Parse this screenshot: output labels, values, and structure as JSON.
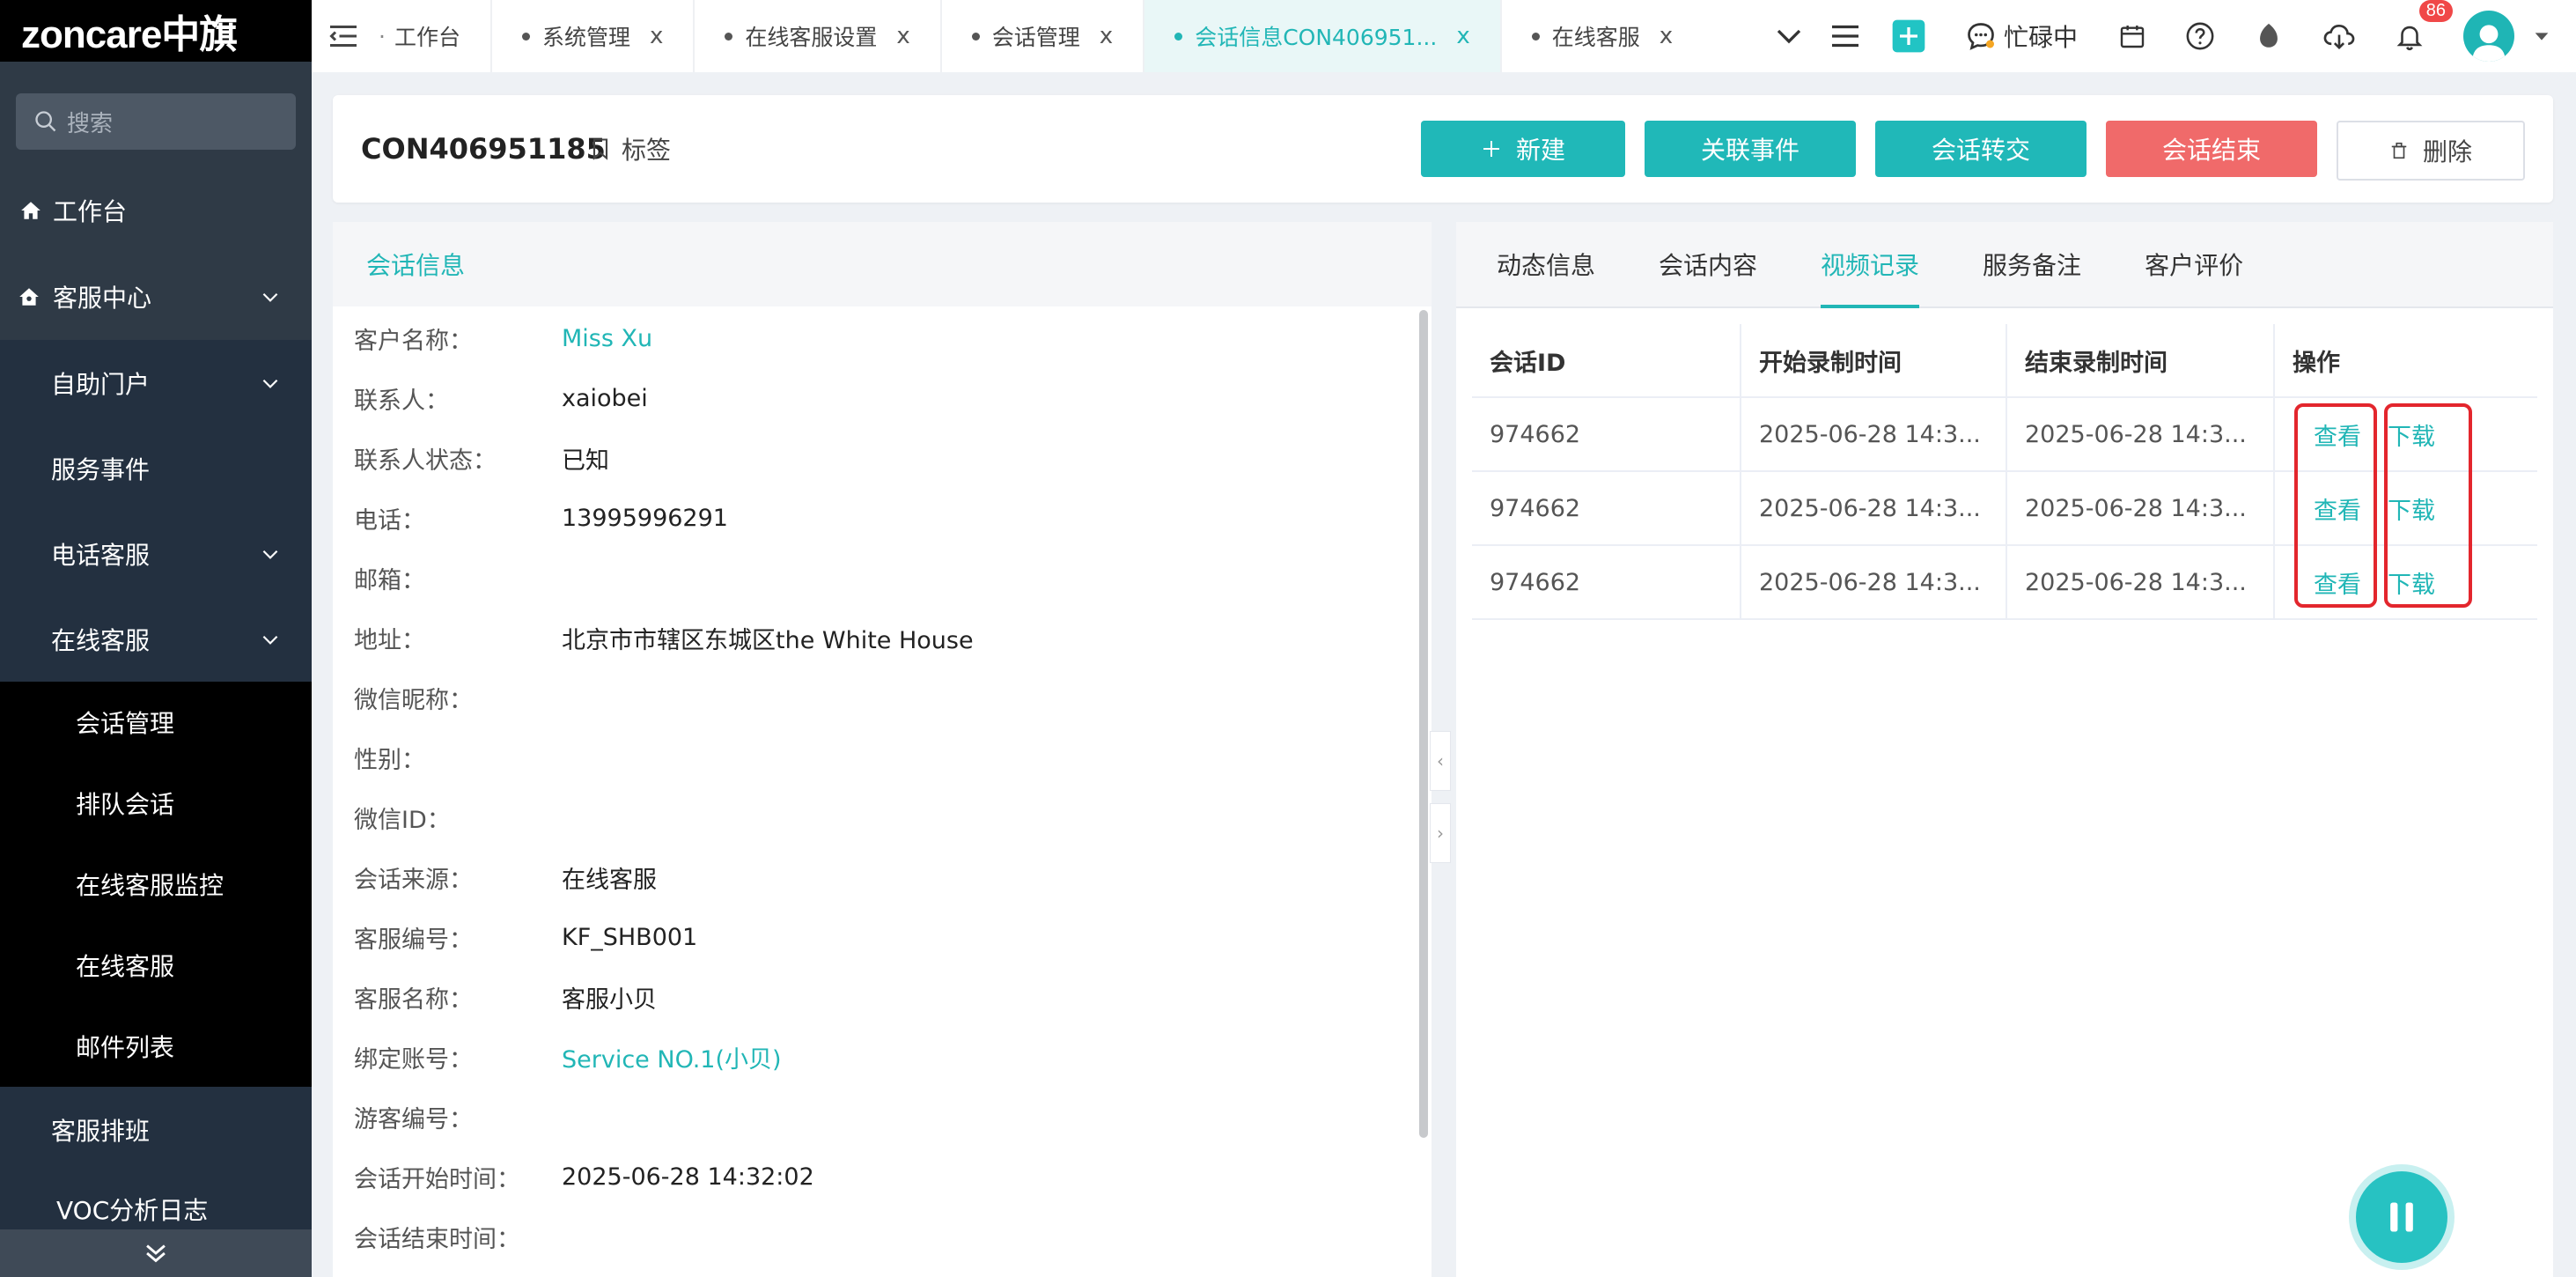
{
  "sidebar": {
    "logo": "zoncare中旗",
    "search_placeholder": "搜索",
    "workbench": "工作台",
    "service_center": "客服中心",
    "self_portal": "自助门户",
    "service_events": "服务事件",
    "phone_service": "电话客服",
    "online_service": "在线客服",
    "online_sub": [
      "会话管理",
      "排队会话",
      "在线客服监控",
      "在线客服",
      "邮件列表"
    ],
    "schedule": "客服排班",
    "voc_log": "VOC分析日志"
  },
  "tabs": [
    {
      "label": "工作台"
    },
    {
      "label": "系统管理"
    },
    {
      "label": "在线客服设置"
    },
    {
      "label": "会话管理"
    },
    {
      "label": "会话信息CON406951..."
    },
    {
      "label": "在线客服"
    }
  ],
  "toolbar": {
    "status": "忙碌中",
    "notification_count": "86"
  },
  "header": {
    "conversation_id": "CON406951185",
    "tag_label": "标签",
    "buttons": {
      "new": "新建",
      "link_event": "关联事件",
      "transfer": "会话转交",
      "end": "会话结束",
      "delete": "删除"
    }
  },
  "info": {
    "title": "会话信息",
    "fields": [
      {
        "label": "客户名称：",
        "value": "Miss Xu"
      },
      {
        "label": "联系人：",
        "value": "xaiobei"
      },
      {
        "label": "联系人状态：",
        "value": "已知"
      },
      {
        "label": "电话：",
        "value": "13995996291"
      },
      {
        "label": "邮箱：",
        "value": ""
      },
      {
        "label": "地址：",
        "value": "北京市市辖区东城区the White House"
      },
      {
        "label": "微信昵称：",
        "value": ""
      },
      {
        "label": "性别：",
        "value": ""
      },
      {
        "label": "微信ID：",
        "value": ""
      },
      {
        "label": "会话来源：",
        "value": "在线客服"
      },
      {
        "label": "客服编号：",
        "value": "KF_SHB001"
      },
      {
        "label": "客服名称：",
        "value": "客服小贝"
      },
      {
        "label": "绑定账号：",
        "value": "Service NO.1(小贝)"
      },
      {
        "label": "游客编号：",
        "value": ""
      },
      {
        "label": "会话开始时间：",
        "value": "2025-06-28 14:32:02"
      },
      {
        "label": "会话结束时间：",
        "value": ""
      }
    ]
  },
  "right": {
    "tabs": [
      "动态信息",
      "会话内容",
      "视频记录",
      "服务备注",
      "客户评价"
    ],
    "active_tab": "视频记录",
    "table": {
      "headers": [
        "会话ID",
        "开始录制时间",
        "结束录制时间",
        "操作"
      ],
      "rows": [
        {
          "id": "974662",
          "start": "2025-06-28 14:3...",
          "end": "2025-06-28 14:3...",
          "view": "查看",
          "download": "下载"
        },
        {
          "id": "974662",
          "start": "2025-06-28 14:3...",
          "end": "2025-06-28 14:3...",
          "view": "查看",
          "download": "下载"
        },
        {
          "id": "974662",
          "start": "2025-06-28 14:3...",
          "end": "2025-06-28 14:3...",
          "view": "查看",
          "download": "下载"
        }
      ]
    }
  },
  "colors": {
    "accent": "#21b6b6",
    "danger": "#f06a6a",
    "highlight": "#e3262d",
    "sidebar": "#2f3a46"
  }
}
